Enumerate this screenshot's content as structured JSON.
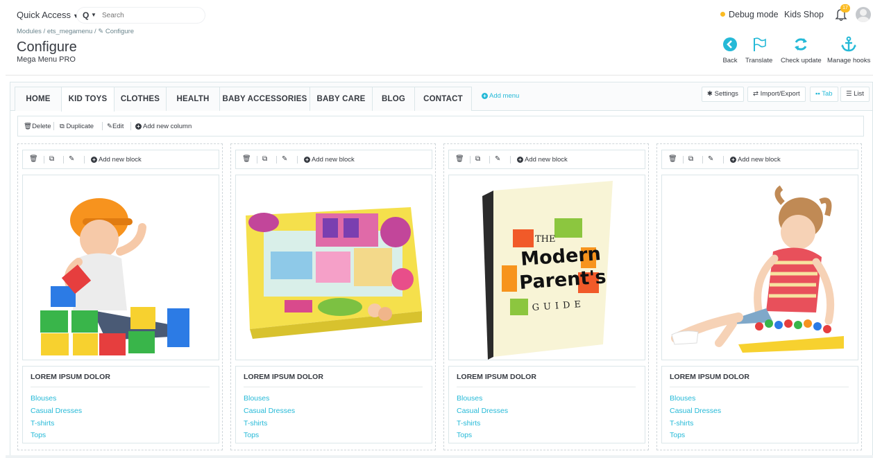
{
  "topbar": {
    "quick_access": "Quick Access",
    "search_placeholder": "Search",
    "debug_mode": "Debug mode",
    "shop_name": "Kids Shop",
    "notification_count": "17"
  },
  "header": {
    "breadcrumb": "Modules  /  ets_megamenu  /  ✎ Configure",
    "title": "Configure",
    "subtitle": "Mega Menu PRO"
  },
  "toolbar": {
    "back": "Back",
    "translate": "Translate",
    "check_update": "Check update",
    "manage_hooks": "Manage hooks"
  },
  "tabs": [
    "HOME",
    "KID TOYS",
    "CLOTHES",
    "HEALTH",
    "BABY ACCESSORIES",
    "BABY CARE",
    "BLOG",
    "CONTACT"
  ],
  "active_tab": "KID TOYS",
  "add_menu": "Add menu",
  "buttons": {
    "settings": "Settings",
    "import_export": "Import/Export",
    "tab": "Tab",
    "list": "List"
  },
  "column_actions": {
    "delete": "Delete",
    "duplicate": "Duplicate",
    "edit": "Edit",
    "add_new_column": "Add new column"
  },
  "add_new_block": "Add new block",
  "columns": [
    {
      "image": "child-with-helmet-and-blocks",
      "block_title": "LOREM IPSUM DOLOR",
      "links": [
        "Blouses",
        "Casual Dresses",
        "T-shirts",
        "Tops"
      ]
    },
    {
      "image": "toy-playset-box",
      "block_title": "LOREM IPSUM DOLOR",
      "links": [
        "Blouses",
        "Casual Dresses",
        "T-shirts",
        "Tops"
      ]
    },
    {
      "image": "modern-parents-guide-book",
      "block_title": "LOREM IPSUM DOLOR",
      "links": [
        "Blouses",
        "Casual Dresses",
        "T-shirts",
        "Tops"
      ]
    },
    {
      "image": "girl-playing-with-toy",
      "block_title": "LOREM IPSUM DOLOR",
      "links": [
        "Blouses",
        "Casual Dresses",
        "T-shirts",
        "Tops"
      ]
    }
  ],
  "book_text": {
    "line1": "THE",
    "line2": "Modern",
    "line3": "Parent's",
    "line4": "GUIDE"
  },
  "colors": {
    "accent": "#25b9d7",
    "warning": "#fbbb22",
    "text": "#363a41",
    "border": "#dbe6e9"
  }
}
